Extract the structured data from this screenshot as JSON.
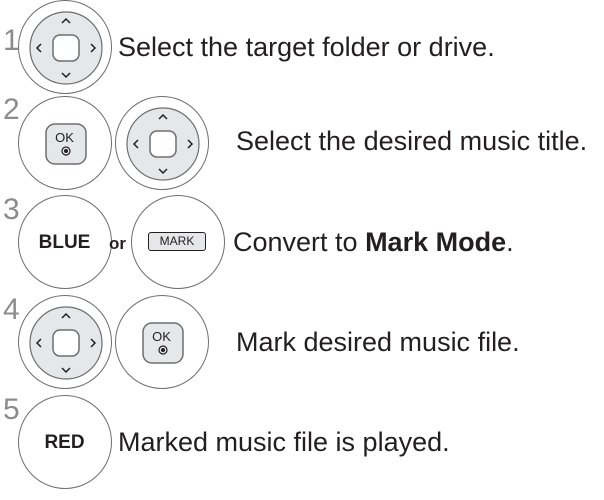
{
  "steps": [
    {
      "number": "1",
      "text": "Select the target folder or drive."
    },
    {
      "number": "2",
      "text": "Select the desired music title.",
      "ok_label": "OK"
    },
    {
      "number": "3",
      "text_before": "Convert to ",
      "text_bold": "Mark Mode",
      "text_after": ".",
      "blue_label": "BLUE",
      "or_label": "or",
      "mark_label": "MARK"
    },
    {
      "number": "4",
      "text": "Mark desired music file.",
      "ok_label": "OK"
    },
    {
      "number": "5",
      "text": "Marked music file is played.",
      "red_label": "RED"
    }
  ],
  "icons": {
    "nav": "navigation-pad-icon",
    "ok": "ok-button-icon"
  }
}
